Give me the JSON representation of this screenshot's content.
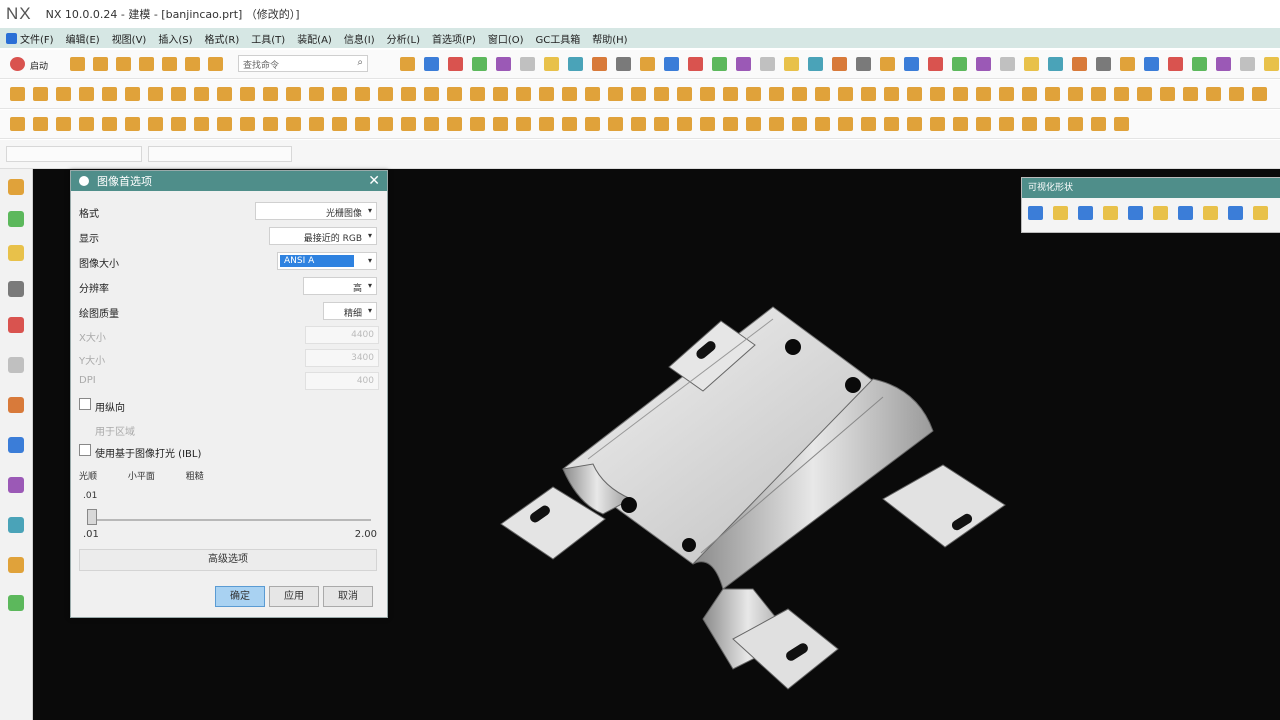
{
  "window": {
    "logo": "NX",
    "title": "NX 10.0.0.24 - 建模 - [banjincao.prt] （修改的）]"
  },
  "menubar": {
    "items": [
      "文件(F)",
      "编辑(E)",
      "视图(V)",
      "插入(S)",
      "格式(R)",
      "工具(T)",
      "装配(A)",
      "信息(I)",
      "分析(L)",
      "首选项(P)",
      "窗口(O)",
      "GC工具箱",
      "帮助(H)"
    ]
  },
  "toolbar": {
    "start_label": "启动",
    "command_finder_placeholder": "查找命令"
  },
  "dialog": {
    "title": "图像首选项",
    "style_label": "格式",
    "style_value": "光栅图像",
    "display_label": "显示",
    "display_value": "最接近的 RGB",
    "size_label": "图像大小",
    "size_value": "ANSI A",
    "resolution_label": "分辨率",
    "resolution_value": "高",
    "quality_label": "绘图质量",
    "quality_value": "精细",
    "x_size_label": "X大小",
    "x_size_value": "4400",
    "y_size_label": "Y大小",
    "y_size_value": "3400",
    "dpi_label": "DPI",
    "dpi_value": "400",
    "use_background_label": "用纵向",
    "use_region_label": "用于区域",
    "use_ibl_label": "使用基于图像打光 (IBL)",
    "smoothness_labels": [
      "光顺",
      "小平面",
      "粗糙"
    ],
    "slider_min_top": ".01",
    "slider_min": ".01",
    "slider_max": "2.00",
    "slider_value": 0.01,
    "advanced_button": "高级选项",
    "ok_button": "确定",
    "apply_button": "应用",
    "cancel_button": "取消"
  },
  "vis_toolbar": {
    "title": "可视化形状"
  },
  "colors": {
    "menubar_bg": "#d6e7e4",
    "dialog_header": "#4f8e8a",
    "viewport_bg": "#0a0a0a",
    "selection": "#2e82e0"
  }
}
